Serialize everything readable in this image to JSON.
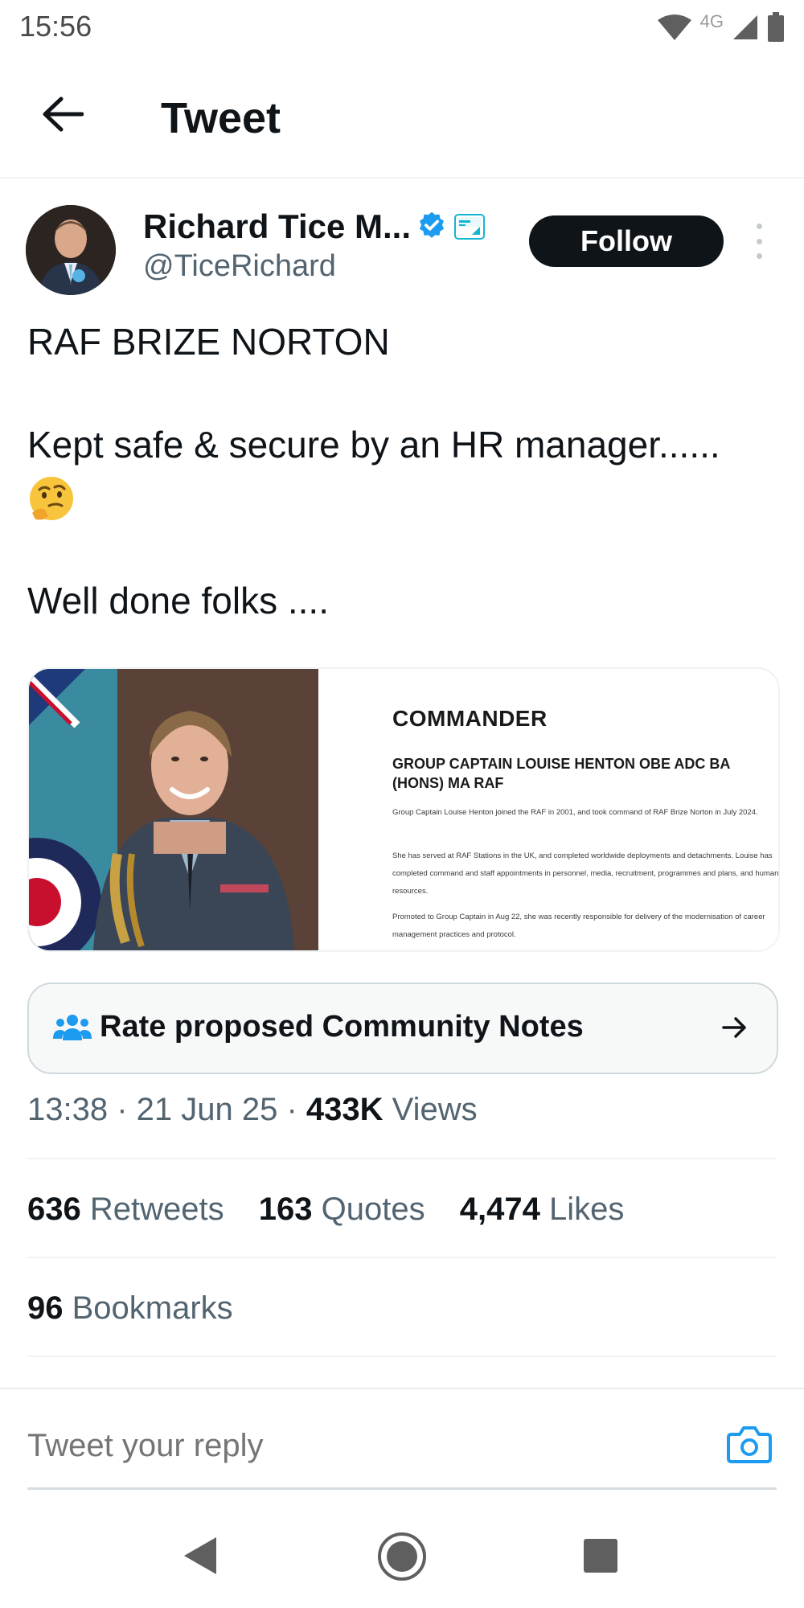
{
  "status_bar": {
    "time": "15:56",
    "network": "4G",
    "icons": [
      "wifi-icon",
      "signal-icon",
      "battery-icon"
    ]
  },
  "header": {
    "title": "Tweet",
    "back_icon": "arrow-left-icon"
  },
  "author": {
    "name": "Richard Tice M...",
    "handle": "@TiceRichard",
    "verified": true,
    "follow_label": "Follow",
    "more_icon": "vertical-ellipsis-icon"
  },
  "tweet": {
    "line1": "RAF BRIZE NORTON",
    "line2": "Kept safe & secure by an HR manager......",
    "emoji": "thinking-face-emoji",
    "line3": "Well done folks ...."
  },
  "media": {
    "heading": "COMMANDER",
    "subheading": "GROUP CAPTAIN LOUISE HENTON OBE ADC BA (HONS) MA RAF",
    "para1": "Group Captain Louise Henton joined the RAF in 2001, and took command of RAF Brize Norton in July 2024.",
    "para2": "She has served at RAF Stations in the UK, and completed worldwide deployments and detachments. Louise has completed command and staff appointments in personnel, media, recruitment, programmes and plans, and human resources.",
    "para3": "Promoted to Group Captain in Aug 22, she was recently responsible for delivery of the modernisation of career management practices and protocol."
  },
  "community_notes": {
    "label": "Rate proposed Community Notes",
    "icon": "people-icon",
    "arrow_icon": "arrow-right-icon",
    "accent": "#1d9bf0"
  },
  "meta": {
    "time": "13:38",
    "date": "21 Jun 25",
    "views_count": "433K",
    "views_label": "Views"
  },
  "stats": {
    "retweets_count": "636",
    "retweets_label": "Retweets",
    "quotes_count": "163",
    "quotes_label": "Quotes",
    "likes_count": "4,474",
    "likes_label": "Likes",
    "bookmarks_count": "96",
    "bookmarks_label": "Bookmarks"
  },
  "reply": {
    "placeholder": "Tweet your reply",
    "camera_icon": "camera-icon"
  },
  "nav_bar": {
    "icons": [
      "nav-back-icon",
      "nav-home-icon",
      "nav-recents-icon"
    ]
  },
  "colors": {
    "text_primary": "#0f1419",
    "text_secondary": "#536471",
    "accent": "#1d9bf0",
    "follow_bg": "#0f1419"
  }
}
